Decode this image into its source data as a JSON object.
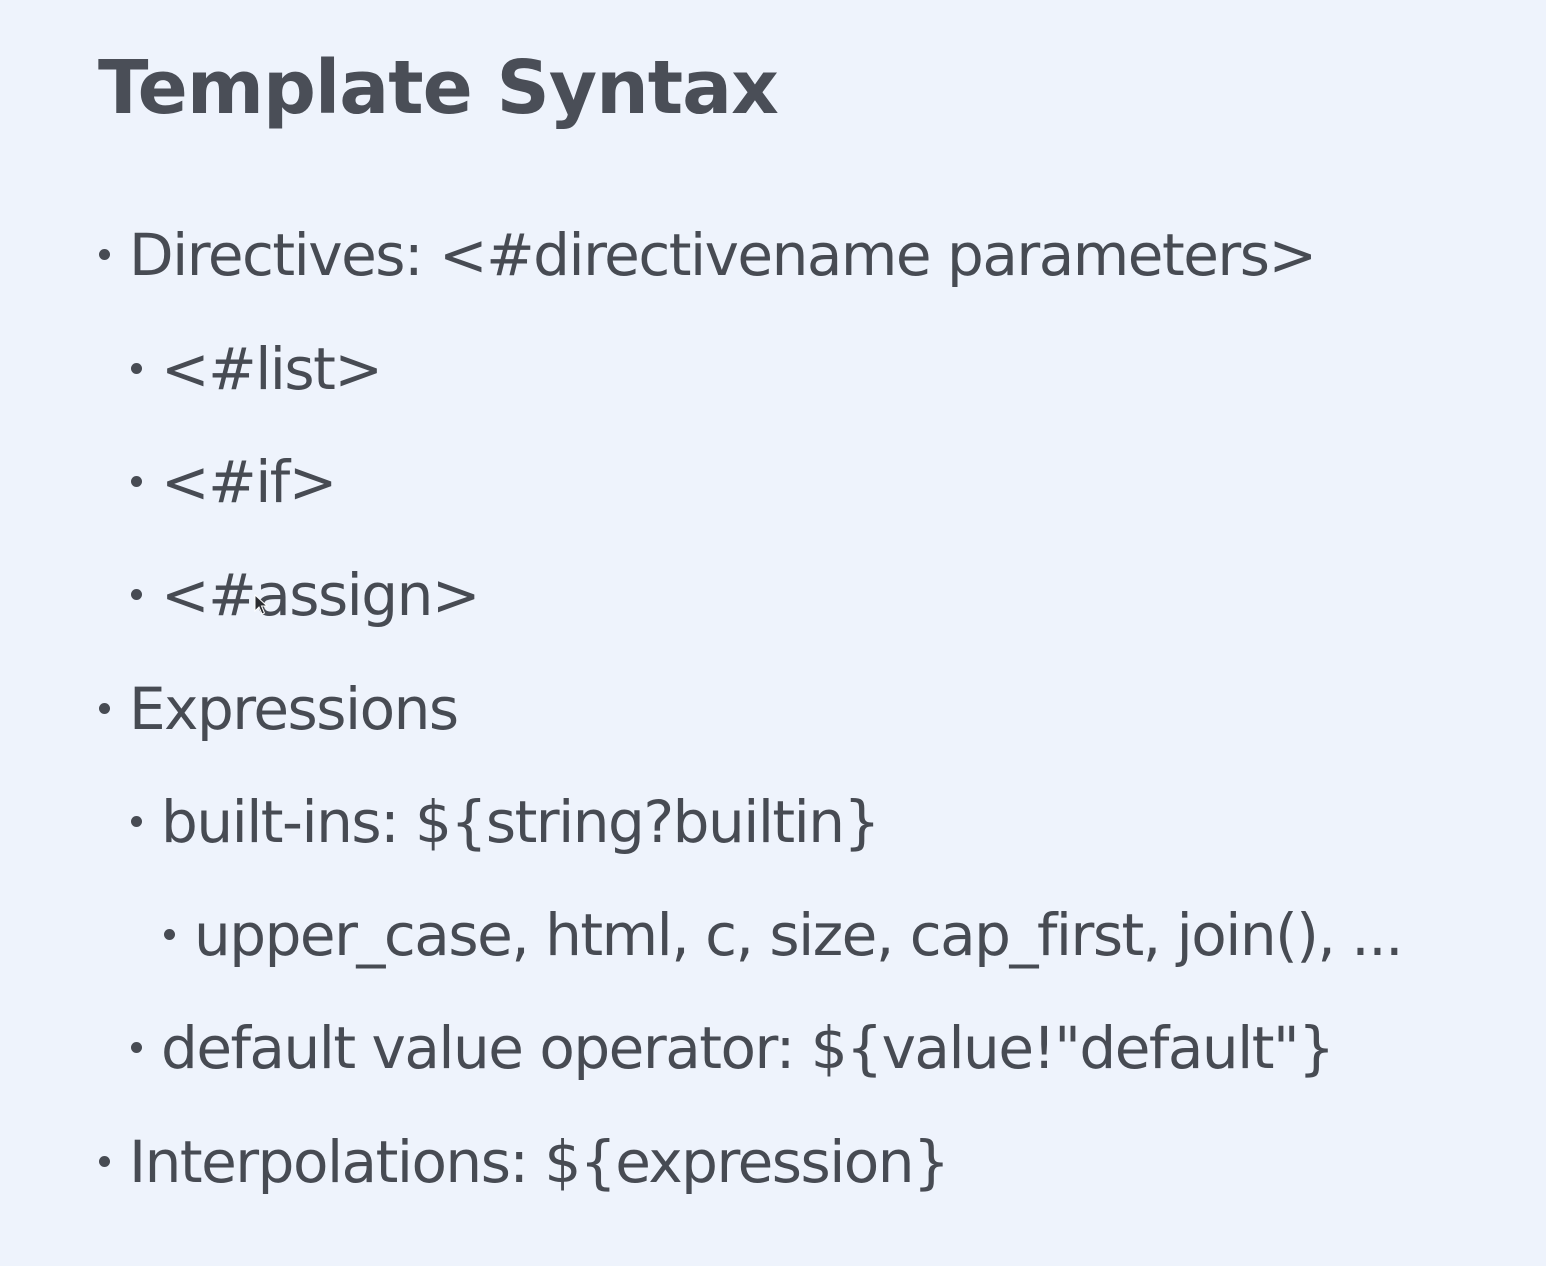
{
  "slide": {
    "title": "Template Syntax",
    "bullets": [
      {
        "level": 1,
        "text": "Directives: <#directivename parameters>"
      },
      {
        "level": 2,
        "text": "<#list>"
      },
      {
        "level": 2,
        "text": "<#if>"
      },
      {
        "level": 2,
        "text": "<#assign>"
      },
      {
        "level": 1,
        "text": "Expressions"
      },
      {
        "level": 2,
        "text": "built-ins: ${string?builtin}"
      },
      {
        "level": 3,
        "text": "upper_case, html, c, size, cap_first, join(), ..."
      },
      {
        "level": 2,
        "text": "default value operator: ${value!\"default\"}"
      },
      {
        "level": 1,
        "text": "Interpolations: ${expression}"
      }
    ]
  },
  "colors": {
    "background": "#eef3fc",
    "text": "#474b53",
    "title": "#4a4e57"
  },
  "icons": {
    "pointer": "mouse-cursor-icon"
  }
}
